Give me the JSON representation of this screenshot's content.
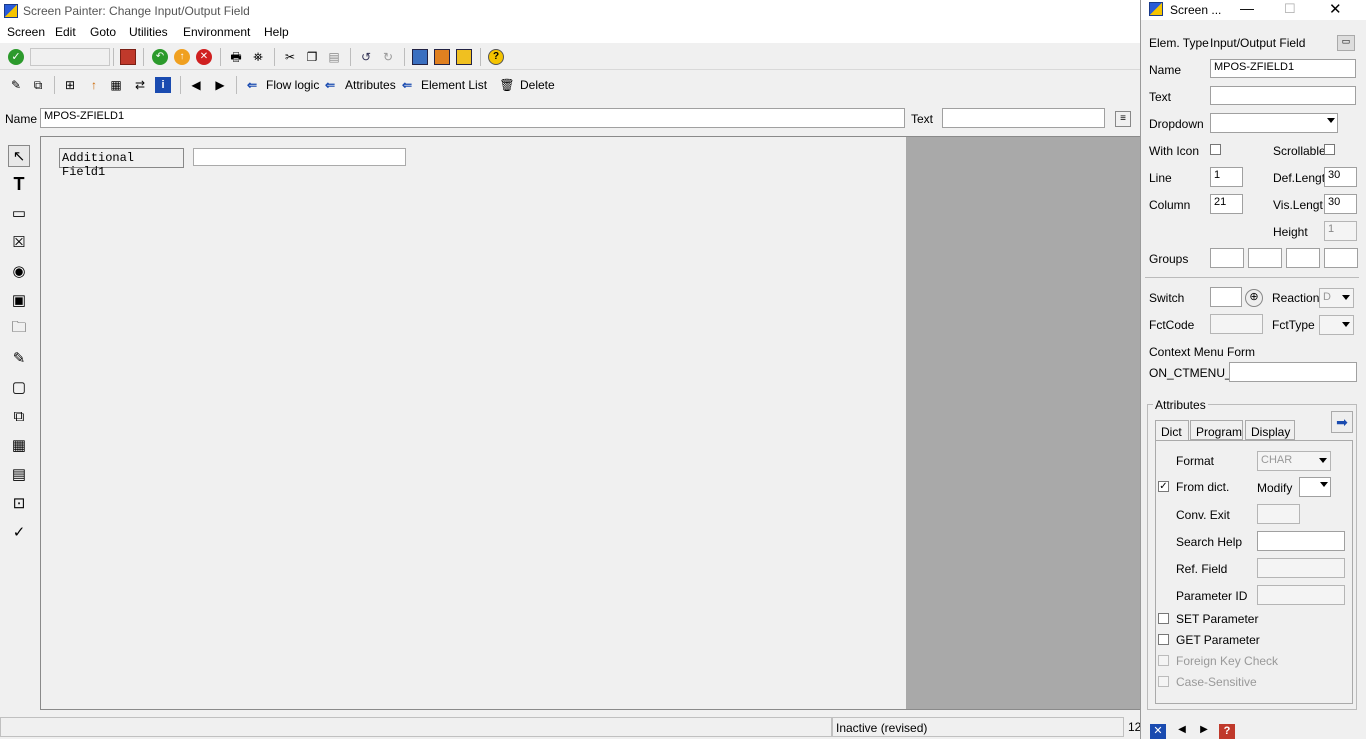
{
  "window": {
    "title": "Screen Painter:  Change Input/Output Field"
  },
  "menu": [
    "Screen",
    "Edit",
    "Goto",
    "Utilities",
    "Environment",
    "Help"
  ],
  "toolbar2": {
    "flow_logic": "Flow logic",
    "attributes": "Attributes",
    "element_list": "Element List",
    "delete": "Delete"
  },
  "namebar": {
    "name_label": "Name",
    "name_value": "MPOS-ZFIELD1",
    "text_label": "Text",
    "text_value": ""
  },
  "canvas": {
    "label_text": "Additional Field1",
    "field_value": ""
  },
  "status": {
    "text": "Inactive (revised)",
    "num": "12"
  },
  "panel": {
    "title": "Screen ...",
    "elem_type_label": "Elem. Type",
    "elem_type_value": "Input/Output Field",
    "name_label": "Name",
    "name_value": "MPOS-ZFIELD1",
    "text_label": "Text",
    "text_value": "",
    "dropdown_label": "Dropdown",
    "dropdown_value": "",
    "with_icon_label": "With Icon",
    "scrollable_label": "Scrollable",
    "line_label": "Line",
    "line_value": "1",
    "def_length_label": "Def.Lengt",
    "def_length_value": "30",
    "column_label": "Column",
    "column_value": "21",
    "vis_length_label": "Vis.Length",
    "vis_length_value": "30",
    "height_label": "Height",
    "height_value": "1",
    "groups_label": "Groups",
    "switch_label": "Switch",
    "reaction_label": "Reaction",
    "reaction_value": "D",
    "fctcode_label": "FctCode",
    "fcttype_label": "FctType",
    "context_menu_label": "Context Menu Form",
    "on_ctmenu_label": "ON_CTMENU_",
    "attributes_label": "Attributes",
    "tabs": [
      "Dict",
      "Program",
      "Display"
    ],
    "format_label": "Format",
    "format_value": "CHAR",
    "from_dict_label": "From dict.",
    "modify_label": "Modify",
    "conv_exit_label": "Conv. Exit",
    "search_help_label": "Search Help",
    "ref_field_label": "Ref. Field",
    "parameter_id_label": "Parameter ID",
    "set_parameter_label": "SET Parameter",
    "get_parameter_label": "GET Parameter",
    "foreign_key_label": "Foreign Key Check",
    "case_sensitive_label": "Case-Sensitive"
  }
}
